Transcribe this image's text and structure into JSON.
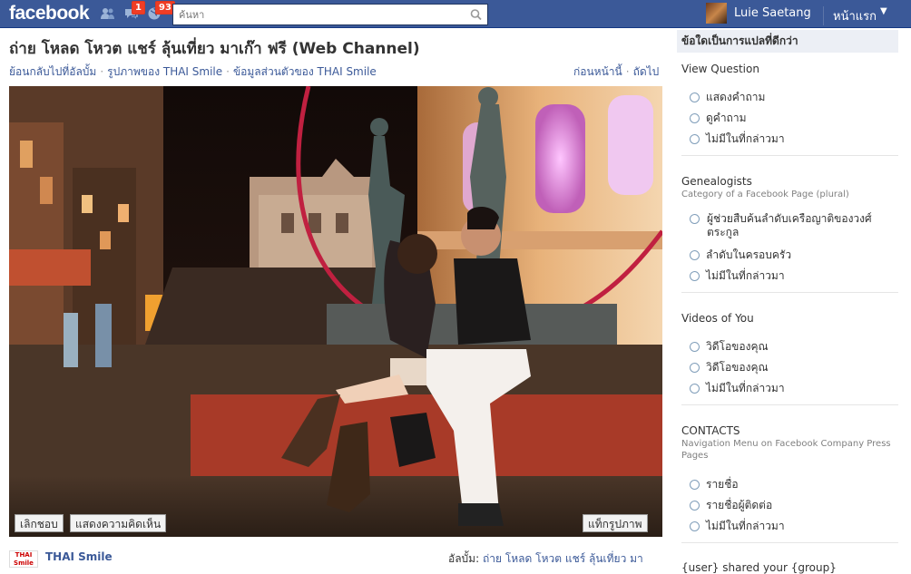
{
  "topbar": {
    "logo": "facebook",
    "notifications": [
      {
        "icon": "friend-requests-icon",
        "count": ""
      },
      {
        "icon": "messages-icon",
        "count": "1"
      },
      {
        "icon": "notifications-globe-icon",
        "count": "93"
      }
    ],
    "search_placeholder": "ค้นหา",
    "user_name": "Luie Saetang",
    "home_label": "หน้าแรก"
  },
  "photo": {
    "title": "ถ่าย โหลด โหวต แชร์ ลุ้นเที่ยว มาเก๊า ฟรี (Web Channel)",
    "crumbs": [
      "ย้อนกลับไปที่อัลบั้ม",
      "รูปภาพของ THAI Smile",
      "ข้อมูลส่วนตัวของ THAI Smile"
    ],
    "prev_label": "ก่อนหน้านี้",
    "next_label": "ถัดไป",
    "unlike_label": "เลิกชอบ",
    "comment_label": "แสดงความคิดเห็น",
    "tag_label": "แท็กรูปภาพ",
    "page_name": "THAI Smile",
    "logo_text": "THAI Smile",
    "album_prefix": "อัลบั้ม:",
    "album_name": "ถ่าย โหลด โหวต แชร์ ลุ้นเที่ยว มา"
  },
  "sidebar": {
    "header": "ข้อใดเป็นการแปลที่ดีกว่า",
    "questions": [
      {
        "title": "View Question",
        "subtitle": "",
        "options": [
          "แสดงคำถาม",
          "ดูคำถาม",
          "ไม่มีในที่กล่าวมา"
        ]
      },
      {
        "title": "Genealogists",
        "subtitle": "Category of a Facebook Page (plural)",
        "options": [
          "ผู้ช่วยสืบค้นลำดับเครือญาติของวงศ์ตระกูล",
          "ลำดับในครอบครัว",
          "ไม่มีในที่กล่าวมา"
        ]
      },
      {
        "title": "Videos of You",
        "subtitle": "",
        "options": [
          "วิดีโอของคุณ",
          "วิดีโอของคุณ",
          "ไม่มีในที่กล่าวมา"
        ]
      },
      {
        "title": "CONTACTS",
        "subtitle": "Navigation Menu on Facebook Company Press Pages",
        "options": [
          "รายชื่อ",
          "รายชื่อผู้ติดต่อ",
          "ไม่มีในที่กล่าวมา"
        ]
      },
      {
        "title": "{user} shared your {group}",
        "subtitle": "",
        "options": []
      }
    ]
  },
  "colors": {
    "brand_blue": "#3b5998",
    "badge_red": "#f03d25",
    "sidebar_header_bg": "#eceff5"
  }
}
